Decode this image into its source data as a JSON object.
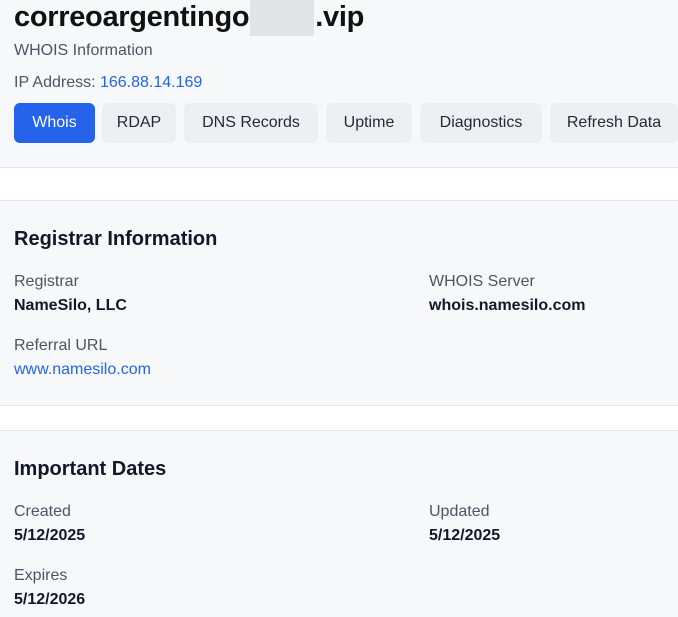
{
  "domain": {
    "title_prefix": "correoargentingo",
    "title_suffix": ".vip",
    "subtitle": "WHOIS Information",
    "ip_label": "IP Address:",
    "ip_value": "166.88.14.169"
  },
  "tabs": [
    {
      "label": "Whois",
      "active": true
    },
    {
      "label": "RDAP",
      "active": false
    },
    {
      "label": "DNS Records",
      "active": false
    },
    {
      "label": "Uptime",
      "active": false
    },
    {
      "label": "Diagnostics",
      "active": false
    },
    {
      "label": "Refresh Data",
      "active": false
    }
  ],
  "registrar": {
    "title": "Registrar Information",
    "registrar_label": "Registrar",
    "registrar_value": "NameSilo, LLC",
    "whois_server_label": "WHOIS Server",
    "whois_server_value": "whois.namesilo.com",
    "referral_label": "Referral URL",
    "referral_value": "www.namesilo.com"
  },
  "dates": {
    "title": "Important Dates",
    "created_label": "Created",
    "created_value": "5/12/2025",
    "updated_label": "Updated",
    "updated_value": "5/12/2025",
    "expires_label": "Expires",
    "expires_value": "5/12/2026"
  },
  "colors": {
    "accent": "#2563eb",
    "background": "#f7f8fa",
    "tab_bg": "#eeeff2"
  }
}
